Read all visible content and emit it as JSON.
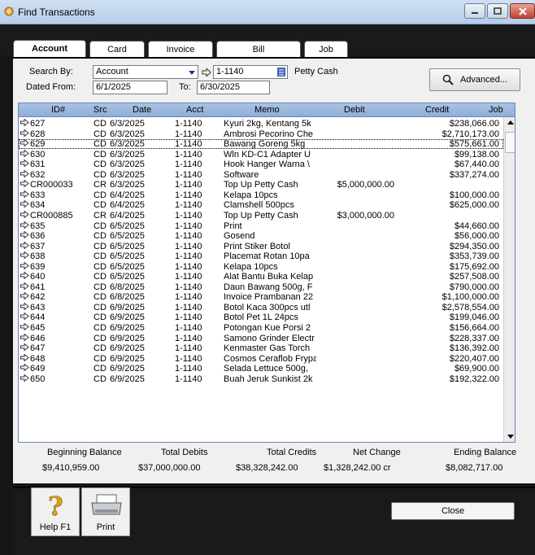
{
  "window": {
    "title": "Find Transactions"
  },
  "tabs": [
    {
      "label": "Account",
      "active": true
    },
    {
      "label": "Card",
      "active": false
    },
    {
      "label": "Invoice",
      "active": false
    },
    {
      "label": "Bill",
      "active": false
    },
    {
      "label": "Job",
      "active": false
    }
  ],
  "search": {
    "search_by_label": "Search By:",
    "search_by_value": "Account",
    "account_value": "1-1140",
    "account_name": "Petty Cash",
    "dated_from_label": "Dated From:",
    "dated_from_value": "6/1/2025",
    "to_label": "To:",
    "to_value": "6/30/2025",
    "advanced_label": "Advanced..."
  },
  "columns": {
    "id": "ID#",
    "src": "Src",
    "date": "Date",
    "acct": "Acct",
    "memo": "Memo",
    "debit": "Debit",
    "credit": "Credit",
    "job": "Job"
  },
  "rows": [
    {
      "id": "627",
      "src": "CD",
      "date": "6/3/2025",
      "acct": "1-1140",
      "memo": "Kyuri 2kg, Kentang 5k",
      "debit": "",
      "credit": "$238,066.00"
    },
    {
      "id": "628",
      "src": "CD",
      "date": "6/3/2025",
      "acct": "1-1140",
      "memo": "Ambrosi Pecorino Che",
      "debit": "",
      "credit": "$2,710,173.00"
    },
    {
      "id": "629",
      "src": "CD",
      "date": "6/3/2025",
      "acct": "1-1140",
      "memo": "Bawang Goreng 5kg",
      "debit": "",
      "credit": "$575,661.00"
    },
    {
      "id": "630",
      "src": "CD",
      "date": "6/3/2025",
      "acct": "1-1140",
      "memo": "Wln KD-C1 Adapter U",
      "debit": "",
      "credit": "$99,138.00"
    },
    {
      "id": "631",
      "src": "CD",
      "date": "6/3/2025",
      "acct": "1-1140",
      "memo": "Hook Hanger Warna \\",
      "debit": "",
      "credit": "$67,440.00"
    },
    {
      "id": "632",
      "src": "CD",
      "date": "6/3/2025",
      "acct": "1-1140",
      "memo": "Software",
      "debit": "",
      "credit": "$337,274.00"
    },
    {
      "id": "CR000033",
      "src": "CR",
      "date": "6/3/2025",
      "acct": "1-1140",
      "memo": "Top Up Petty Cash",
      "debit": "$5,000,000.00",
      "credit": ""
    },
    {
      "id": "633",
      "src": "CD",
      "date": "6/4/2025",
      "acct": "1-1140",
      "memo": "Kelapa 10pcs",
      "debit": "",
      "credit": "$100,000.00"
    },
    {
      "id": "634",
      "src": "CD",
      "date": "6/4/2025",
      "acct": "1-1140",
      "memo": "Clamshell 500pcs",
      "debit": "",
      "credit": "$625,000.00"
    },
    {
      "id": "CR000885",
      "src": "CR",
      "date": "6/4/2025",
      "acct": "1-1140",
      "memo": "Top Up Petty Cash",
      "debit": "$3,000,000.00",
      "credit": ""
    },
    {
      "id": "635",
      "src": "CD",
      "date": "6/5/2025",
      "acct": "1-1140",
      "memo": "Print",
      "debit": "",
      "credit": "$44,660.00"
    },
    {
      "id": "636",
      "src": "CD",
      "date": "6/5/2025",
      "acct": "1-1140",
      "memo": "Gosend",
      "debit": "",
      "credit": "$56,000.00"
    },
    {
      "id": "637",
      "src": "CD",
      "date": "6/5/2025",
      "acct": "1-1140",
      "memo": "Print Stiker Botol",
      "debit": "",
      "credit": "$294,350.00"
    },
    {
      "id": "638",
      "src": "CD",
      "date": "6/5/2025",
      "acct": "1-1140",
      "memo": "Placemat Rotan 10pa",
      "debit": "",
      "credit": "$353,739.00"
    },
    {
      "id": "639",
      "src": "CD",
      "date": "6/5/2025",
      "acct": "1-1140",
      "memo": "Kelapa 10pcs",
      "debit": "",
      "credit": "$175,692.00"
    },
    {
      "id": "640",
      "src": "CD",
      "date": "6/5/2025",
      "acct": "1-1140",
      "memo": "Alat Bantu Buka Kelap",
      "debit": "",
      "credit": "$257,508.00"
    },
    {
      "id": "641",
      "src": "CD",
      "date": "6/8/2025",
      "acct": "1-1140",
      "memo": "Daun Bawang 500g, F",
      "debit": "",
      "credit": "$790,000.00"
    },
    {
      "id": "642",
      "src": "CD",
      "date": "6/8/2025",
      "acct": "1-1140",
      "memo": "Invoice Prambanan 22",
      "debit": "",
      "credit": "$1,100,000.00"
    },
    {
      "id": "643",
      "src": "CD",
      "date": "6/9/2025",
      "acct": "1-1140",
      "memo": "Botol Kaca 300pcs utl",
      "debit": "",
      "credit": "$2,578,554.00"
    },
    {
      "id": "644",
      "src": "CD",
      "date": "6/9/2025",
      "acct": "1-1140",
      "memo": "Botol Pet 1L 24pcs",
      "debit": "",
      "credit": "$199,046.00"
    },
    {
      "id": "645",
      "src": "CD",
      "date": "6/9/2025",
      "acct": "1-1140",
      "memo": "Potongan Kue Porsi 2",
      "debit": "",
      "credit": "$156,664.00"
    },
    {
      "id": "646",
      "src": "CD",
      "date": "6/9/2025",
      "acct": "1-1140",
      "memo": "Samono Grinder Electr",
      "debit": "",
      "credit": "$228,337.00"
    },
    {
      "id": "647",
      "src": "CD",
      "date": "6/9/2025",
      "acct": "1-1140",
      "memo": "Kenmaster Gas Torch",
      "debit": "",
      "credit": "$136,392.00"
    },
    {
      "id": "648",
      "src": "CD",
      "date": "6/9/2025",
      "acct": "1-1140",
      "memo": "Cosmos Ceraflob Frypa",
      "debit": "",
      "credit": "$220,407.00"
    },
    {
      "id": "649",
      "src": "CD",
      "date": "6/9/2025",
      "acct": "1-1140",
      "memo": "Selada Lettuce 500g,",
      "debit": "",
      "credit": "$69,900.00"
    },
    {
      "id": "650",
      "src": "CD",
      "date": "6/9/2025",
      "acct": "1-1140",
      "memo": "Buah Jeruk Sunkist 2k",
      "debit": "",
      "credit": "$192,322.00"
    }
  ],
  "selected_row": 2,
  "totals": {
    "beginning_balance_label": "Beginning Balance",
    "beginning_balance": "$9,410,959.00",
    "total_debits_label": "Total Debits",
    "total_debits": "$37,000,000.00",
    "total_credits_label": "Total Credits",
    "total_credits": "$38,328,242.00",
    "net_change_label": "Net Change",
    "net_change": "$1,328,242.00 cr",
    "ending_balance_label": "Ending Balance",
    "ending_balance": "$8,082,717.00"
  },
  "footer": {
    "help_label": "Help F1",
    "print_label": "Print",
    "close_label": "Close"
  },
  "colors": {
    "grid_header": "#9db8de",
    "title_bar": "#c4d8ef",
    "close_button": "#c5432f"
  }
}
